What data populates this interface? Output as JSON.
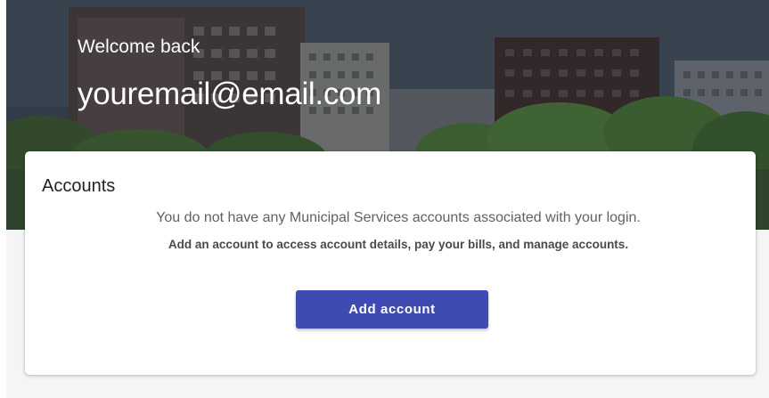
{
  "hero": {
    "welcome": "Welcome back",
    "email": "youremail@email.com"
  },
  "accounts_card": {
    "title": "Accounts",
    "message": "You do not have any Municipal Services accounts associated with your login.",
    "subtext": "Add an account to access account details, pay your bills, and manage accounts.",
    "add_button_label": "Add account"
  },
  "colors": {
    "primary_button": "#3f4bb0",
    "page_background": "#f5f5f5",
    "card_background": "#ffffff"
  }
}
